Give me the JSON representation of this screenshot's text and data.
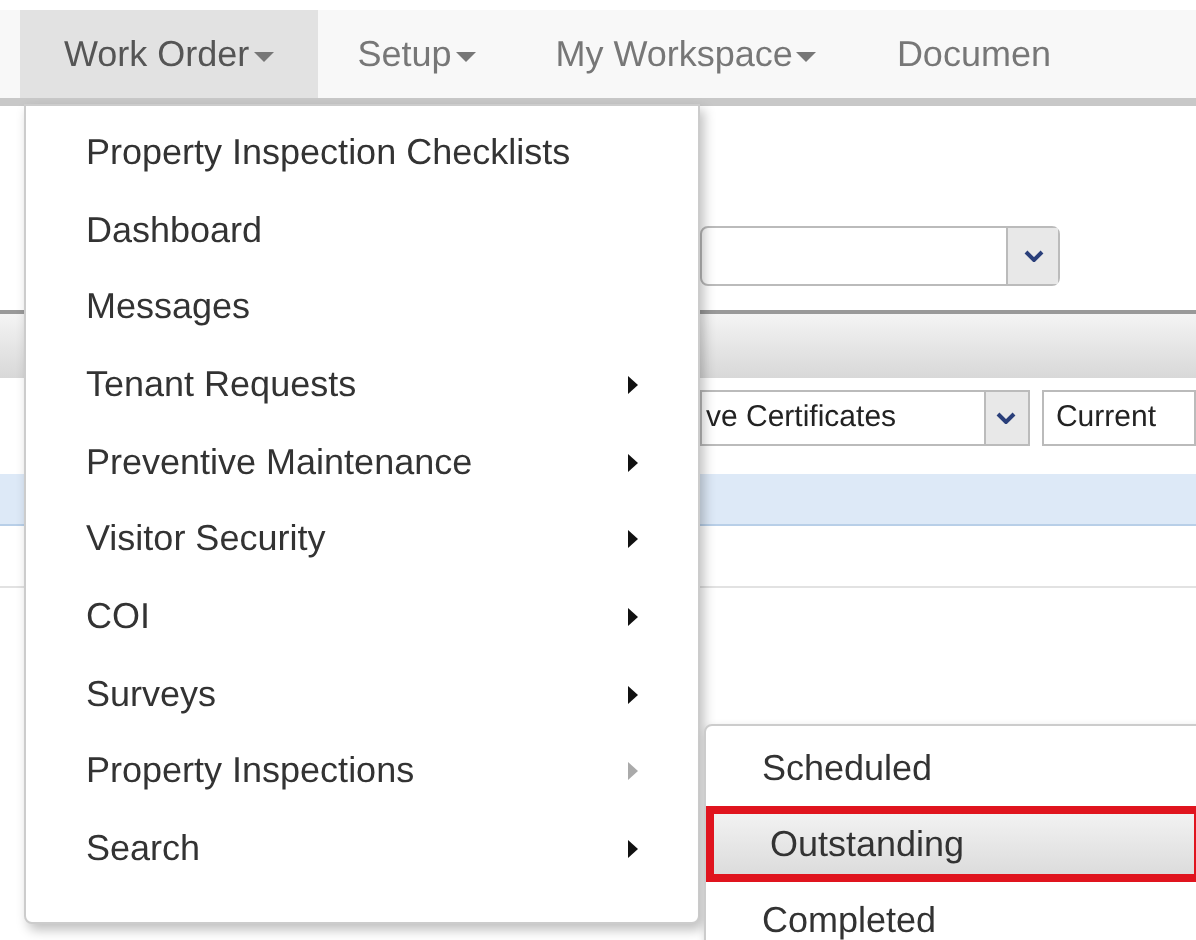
{
  "nav": [
    {
      "label": "Work Order",
      "selected": true
    },
    {
      "label": "Setup",
      "selected": false
    },
    {
      "label": "My Workspace",
      "selected": false
    },
    {
      "label": "Documen",
      "selected": false
    }
  ],
  "background": {
    "filter_select": "ve Certificates",
    "status_select": "Current"
  },
  "menu": [
    {
      "label": "Property Inspection Checklists"
    },
    {
      "label": "Dashboard"
    },
    {
      "label": "Messages"
    },
    {
      "label": "Tenant Requests",
      "has_submenu": true,
      "expanded": false
    },
    {
      "label": "Preventive Maintenance",
      "has_submenu": true,
      "expanded": false
    },
    {
      "label": "Visitor Security",
      "has_submenu": true,
      "expanded": false
    },
    {
      "label": "COI",
      "has_submenu": true,
      "expanded": false
    },
    {
      "label": "Surveys",
      "has_submenu": true,
      "expanded": false
    },
    {
      "label": "Property Inspections",
      "has_submenu": true,
      "expanded": true
    },
    {
      "label": "Search",
      "has_submenu": true,
      "expanded": false
    }
  ],
  "submenu": [
    {
      "label": "Scheduled",
      "selected": false
    },
    {
      "label": "Outstanding",
      "selected": true
    },
    {
      "label": "Completed",
      "selected": false
    }
  ]
}
